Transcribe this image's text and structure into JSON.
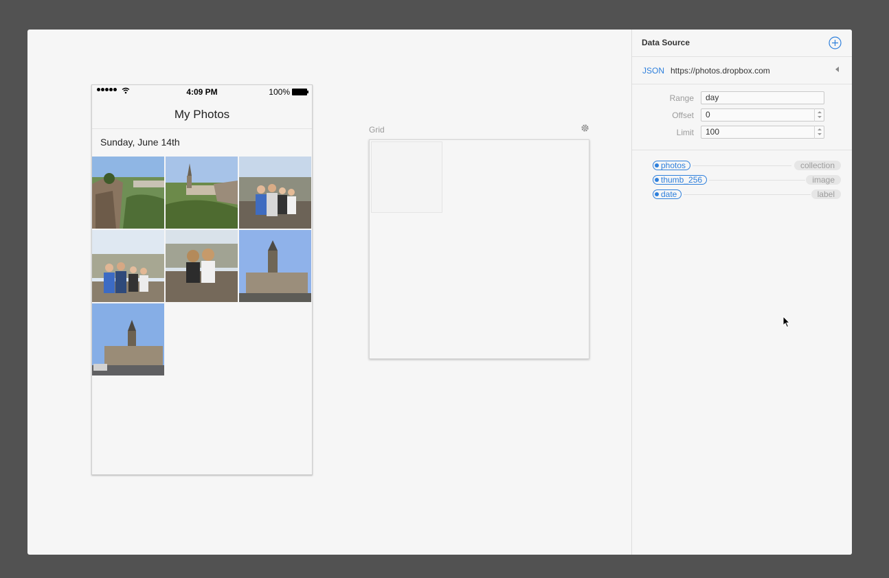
{
  "phone": {
    "status_time": "4:09 PM",
    "battery_percent": "100%",
    "nav_title": "My Photos",
    "section_header": "Sunday, June 14th",
    "photos": [
      {
        "subject": "castle-ruins-landscape"
      },
      {
        "subject": "valley-church-landscape"
      },
      {
        "subject": "group-photo-city-view"
      },
      {
        "subject": "group-photo-overlook"
      },
      {
        "subject": "two-friends-photo"
      },
      {
        "subject": "church-tower"
      },
      {
        "subject": "church-street"
      }
    ]
  },
  "canvas": {
    "grid_label": "Grid"
  },
  "panel": {
    "title": "Data Source",
    "source_type": "JSON",
    "source_url": "https://photos.dropbox.com",
    "params": [
      {
        "label": "Range",
        "value": "day"
      },
      {
        "label": "Offset",
        "value": "0"
      },
      {
        "label": "Limit",
        "value": "100"
      }
    ],
    "mappings": [
      {
        "key": "photos",
        "type": "collection"
      },
      {
        "key": "thumb_256",
        "type": "image"
      },
      {
        "key": "date",
        "type": "label"
      }
    ]
  },
  "colors": {
    "accent": "#2d7fdc",
    "desktop": "#525252",
    "window": "#f6f6f6"
  }
}
